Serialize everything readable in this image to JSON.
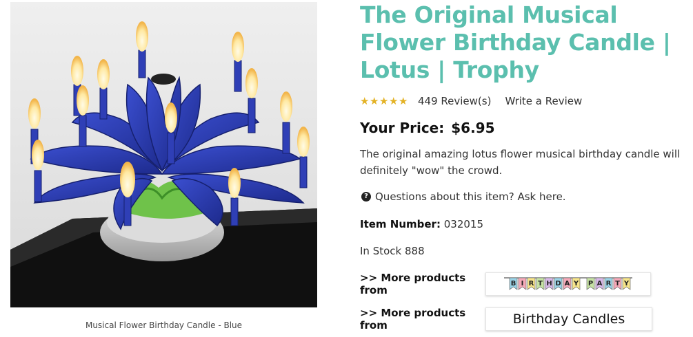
{
  "product": {
    "title": "The Original Musical Flower Birthday Candle | Lotus | Trophy",
    "rating": 4.5,
    "rating_max": 5,
    "reviews_label": "449 Review(s)",
    "write_review_label": "Write a Review",
    "price_label": "Your Price:",
    "price": "$6.95",
    "description": "The original amazing lotus flower musical birthday candle will definitely \"wow\" the crowd.",
    "questions_label": "Questions about this item? Ask here.",
    "item_number_label": "Item Number:",
    "item_number": "032015",
    "stock_label": "In Stock 888",
    "image_caption": "Musical Flower Birthday Candle - Blue"
  },
  "more_products": [
    {
      "label": ">> More products from",
      "link_text": "BIRTHDAY PARTY",
      "style": "banner"
    },
    {
      "label": ">> More products from",
      "link_text": "Birthday Candles",
      "style": "text"
    }
  ],
  "colors": {
    "title": "#5bbfae",
    "star_on": "#e3b225",
    "star_off": "#b9b9b9",
    "petal": "#2f3fb6",
    "banner_flags": [
      "#9ad3e6",
      "#f5a9b8",
      "#f6e48a",
      "#c6e2a4",
      "#d8b8e8"
    ]
  }
}
